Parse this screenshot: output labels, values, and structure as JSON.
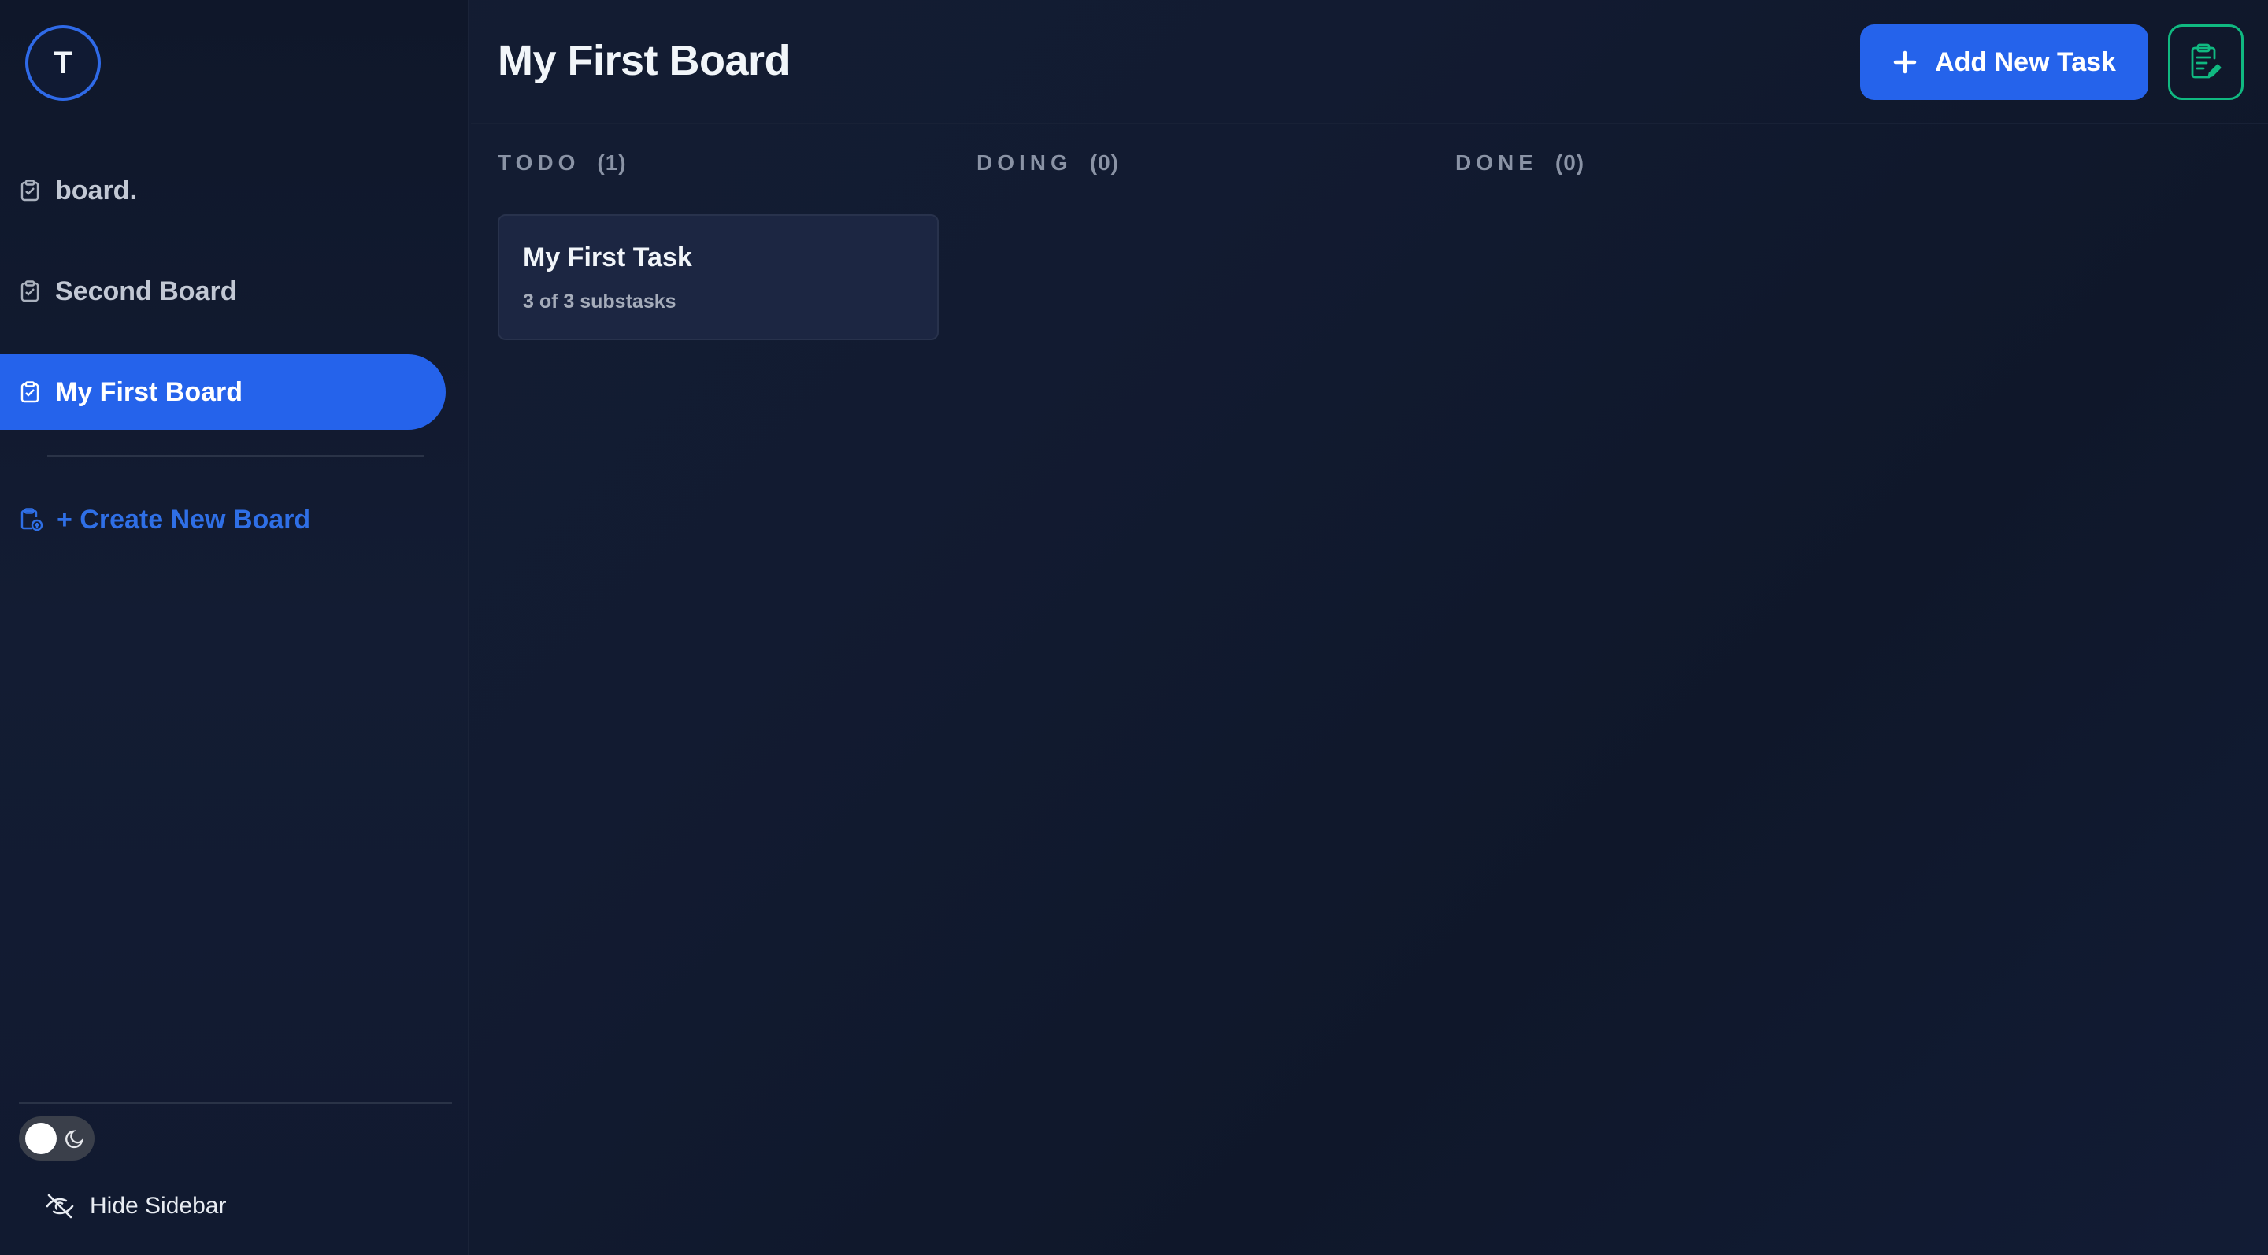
{
  "user": {
    "avatar_initial": "T"
  },
  "sidebar": {
    "boards": [
      {
        "label": "board."
      },
      {
        "label": "Second Board"
      },
      {
        "label": "My First Board",
        "active": true
      }
    ],
    "create_board_label": "+ Create New Board",
    "hide_sidebar_label": "Hide Sidebar",
    "theme": "dark"
  },
  "header": {
    "title": "My First Board",
    "add_task_label": "Add New Task"
  },
  "columns": [
    {
      "name": "TODO",
      "count": "(1)"
    },
    {
      "name": "DOING",
      "count": "(0)"
    },
    {
      "name": "DONE",
      "count": "(0)"
    }
  ],
  "tasks": [
    {
      "title": "My First Task",
      "subtasks": "3 of 3 substasks"
    }
  ],
  "colors": {
    "accent": "#2563eb",
    "edit_accent": "#10b981",
    "background": "#0f172a"
  }
}
